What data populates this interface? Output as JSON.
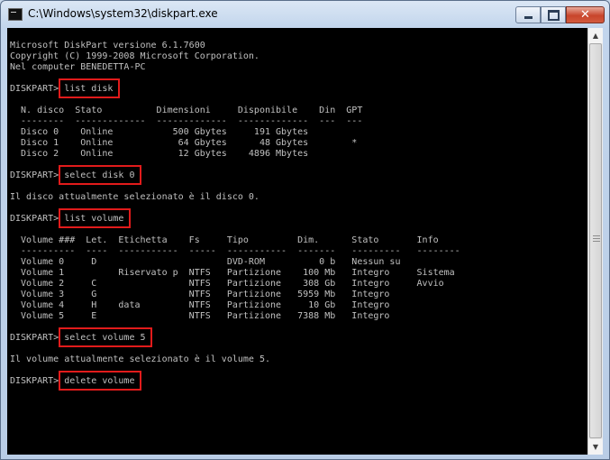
{
  "window": {
    "title": "C:\\Windows\\system32\\diskpart.exe"
  },
  "controls": {
    "close": "✕"
  },
  "colors": {
    "console_bg": "#000000",
    "console_text": "#c0c0c0",
    "highlight": "#e11b1b",
    "titlebar": "#c2d5ec"
  },
  "console": {
    "lines": [
      "Microsoft DiskPart versione 6.1.7600",
      "Copyright (C) 1999-2008 Microsoft Corporation.",
      "Nel computer BENEDETTA-PC",
      "",
      "DISKPART> list disk",
      "",
      "  N. disco  Stato          Dimensioni     Disponibile    Din  GPT",
      "  --------  -------------  -------------  -------------  ---  ---",
      "  Disco 0    Online           500 Gbytes     191 Gbytes",
      "  Disco 1    Online            64 Gbytes      48 Gbytes        *",
      "  Disco 2    Online            12 Gbytes    4896 Mbytes",
      "",
      "DISKPART> select disk 0",
      "",
      "Il disco attualmente selezionato è il disco 0.",
      "",
      "DISKPART> list volume",
      "",
      "  Volume ###  Let.  Etichetta    Fs     Tipo         Dim.      Stato       Info",
      "  ----------  ----  -----------  -----  -----------  -------   ---------   --------",
      "  Volume 0     D                        DVD-ROM          0 b   Nessun su",
      "  Volume 1          Riservato p  NTFS   Partizione    100 Mb   Integro     Sistema",
      "  Volume 2     C                 NTFS   Partizione    308 Gb   Integro     Avvio",
      "  Volume 3     G                 NTFS   Partizione   5959 Mb   Integro",
      "  Volume 4     H    data         NTFS   Partizione     10 Gb   Integro",
      "  Volume 5     E                 NTFS   Partizione   7388 Mb   Integro",
      "",
      "DISKPART> select volume 5",
      "",
      "Il volume attualmente selezionato è il volume 5.",
      "",
      "DISKPART> delete volume"
    ]
  },
  "highlighted_commands": [
    "list disk",
    "select disk 0",
    "list volume",
    "select volume 5",
    "delete volume"
  ]
}
